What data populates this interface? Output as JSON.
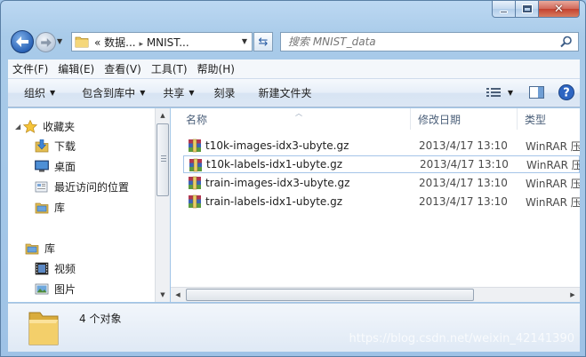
{
  "address": {
    "crumb": "« 数据... ▸ MNIST...",
    "crumb_a": "«",
    "crumb_b": "数据...",
    "crumb_sep": "▸",
    "crumb_c": "MNIST..."
  },
  "search": {
    "placeholder": "搜索 MNIST_data"
  },
  "menu": [
    "文件(F)",
    "编辑(E)",
    "查看(V)",
    "工具(T)",
    "帮助(H)"
  ],
  "commands": [
    {
      "label": "组织",
      "dropdown": true
    },
    {
      "label": "包含到库中",
      "dropdown": true
    },
    {
      "label": "共享",
      "dropdown": true
    },
    {
      "label": "刻录",
      "dropdown": false
    },
    {
      "label": "新建文件夹",
      "dropdown": false
    }
  ],
  "nav": {
    "favorites": "收藏夹",
    "fav_items": [
      "下载",
      "桌面",
      "最近访问的位置",
      "库"
    ],
    "libraries": "库",
    "lib_items": [
      "视频",
      "图片"
    ]
  },
  "columns": {
    "name": "名称",
    "date": "修改日期",
    "type": "类型"
  },
  "files": [
    {
      "name": "t10k-images-idx3-ubyte.gz",
      "date": "2013/4/17 13:10",
      "type": "WinRAR 压"
    },
    {
      "name": "t10k-labels-idx1-ubyte.gz",
      "date": "2013/4/17 13:10",
      "type": "WinRAR 压"
    },
    {
      "name": "train-images-idx3-ubyte.gz",
      "date": "2013/4/17 13:10",
      "type": "WinRAR 压"
    },
    {
      "name": "train-labels-idx1-ubyte.gz",
      "date": "2013/4/17 13:10",
      "type": "WinRAR 压"
    }
  ],
  "details": {
    "count": "4 个对象"
  },
  "watermark": "https://blog.csdn.net/weixin_42141390",
  "colors": {
    "frame": "#a9cbe9",
    "selection_border": "#a5c5e8",
    "close": "#c4422f"
  }
}
